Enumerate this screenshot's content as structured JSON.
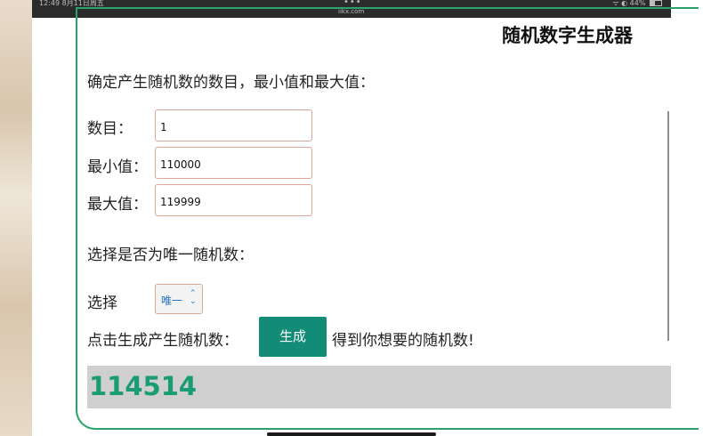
{
  "status_bar": {
    "time_date": "12:49 8月11日周五",
    "dots": "•••",
    "url": "iikx.com",
    "indicators": "ᯤ ◐ 44%"
  },
  "app": {
    "title": "随机数字生成器",
    "intro": "确定产生随机数的数目，最小值和最大值：",
    "fields": [
      {
        "label": "数目：",
        "value": "1"
      },
      {
        "label": "最小值：",
        "value": "110000"
      },
      {
        "label": "最大值：",
        "value": "119999"
      }
    ],
    "unique_section_label": "选择是否为唯一随机数：",
    "select_label": "选择",
    "select_value": "唯一",
    "click_prompt": "点击生成产生随机数：",
    "generate_button": "生成",
    "after_button_text": "得到你想要的随机数!",
    "result": "114514"
  },
  "colors": {
    "accent_green": "#2aa36b",
    "button_teal": "#138c77",
    "result_text": "#199b73",
    "result_bg": "#cfcfcf"
  }
}
